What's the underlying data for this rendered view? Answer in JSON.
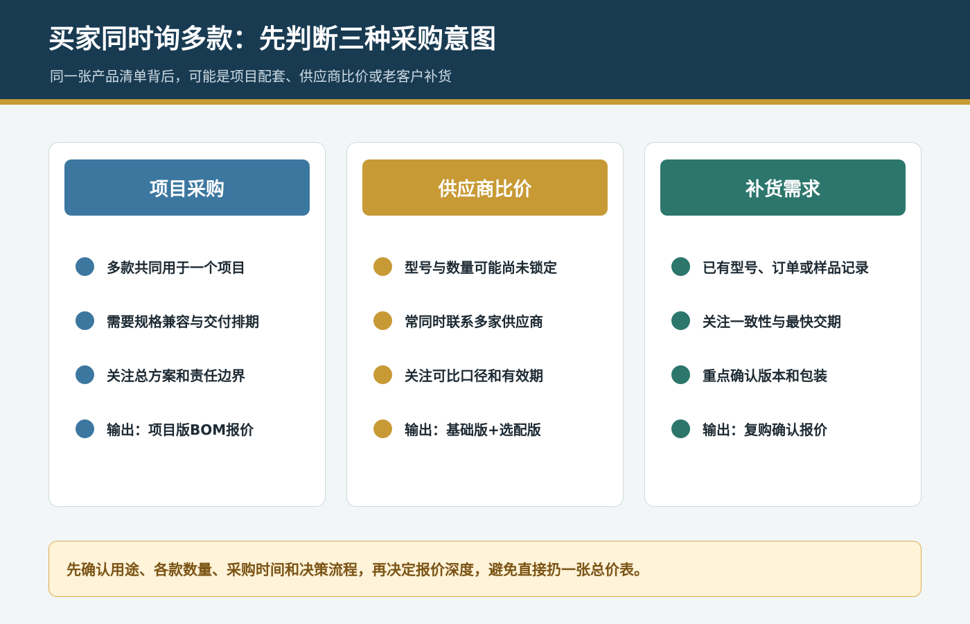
{
  "header": {
    "title": "买家同时询多款：先判断三种采购意图",
    "subtitle": "同一张产品清单背后，可能是项目配套、供应商比价或老客户补货"
  },
  "colors": {
    "header_bg": "#183b52",
    "accent_rule": "#c89a35",
    "project": "#3c77a0",
    "compare": "#c89a35",
    "restock": "#2c766c",
    "note_bg": "#fff3d9",
    "note_text": "#7a5314"
  },
  "cards": [
    {
      "title": "项目采购",
      "color": "#3c77a0",
      "items": [
        "多款共同用于一个项目",
        "需要规格兼容与交付排期",
        "关注总方案和责任边界",
        "输出：项目版BOM报价"
      ]
    },
    {
      "title": "供应商比价",
      "color": "#c89a35",
      "items": [
        "型号与数量可能尚未锁定",
        "常同时联系多家供应商",
        "关注可比口径和有效期",
        "输出：基础版+选配版"
      ]
    },
    {
      "title": "补货需求",
      "color": "#2c766c",
      "items": [
        "已有型号、订单或样品记录",
        "关注一致性与最快交期",
        "重点确认版本和包装",
        "输出：复购确认报价"
      ]
    }
  ],
  "note": {
    "text": "先确认用途、各款数量、采购时间和决策流程，再决定报价深度，避免直接扔一张总价表。"
  }
}
